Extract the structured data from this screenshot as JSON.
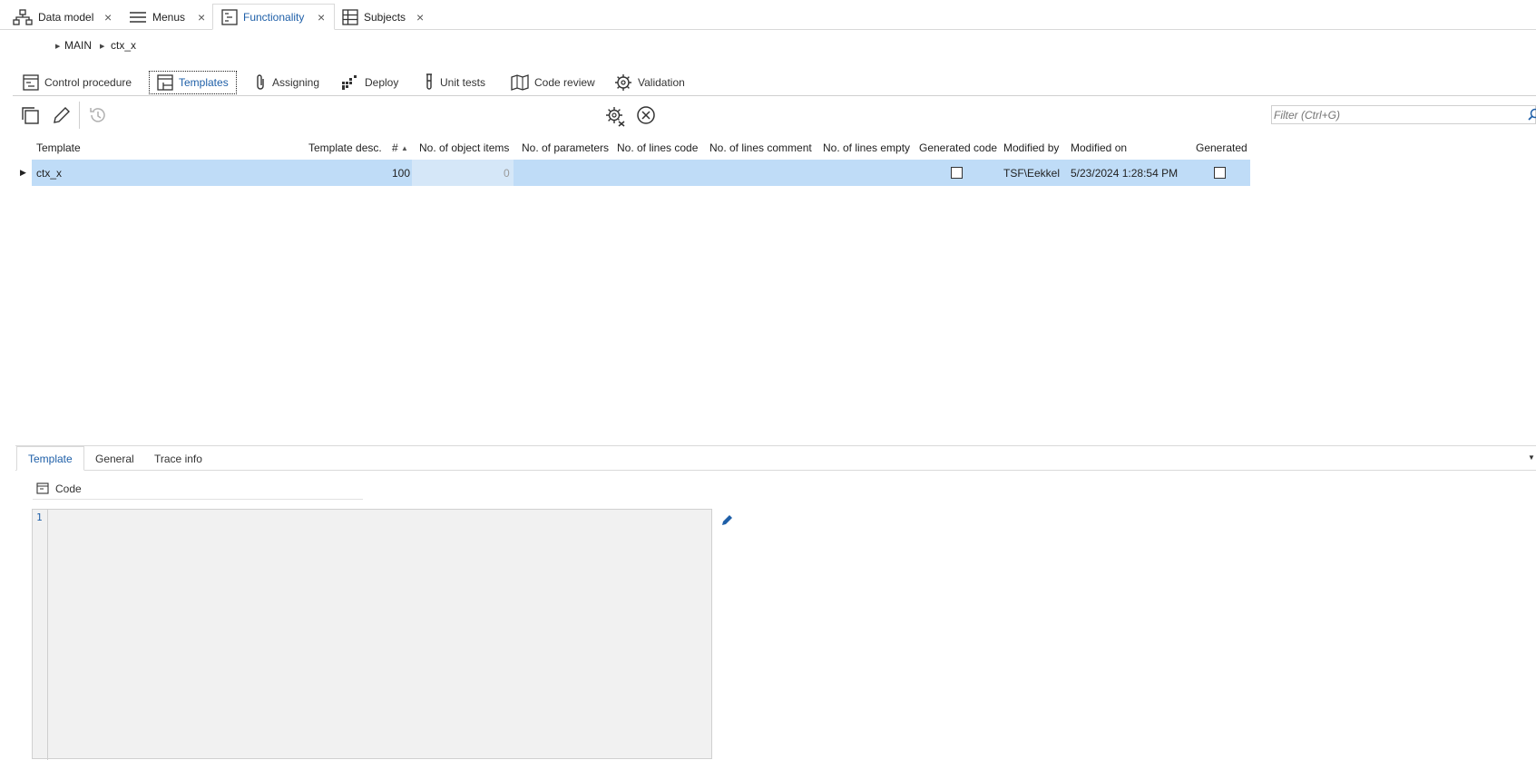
{
  "doc_tabs": [
    {
      "label": "Data model",
      "icon": "sitemap-icon",
      "close": "×"
    },
    {
      "label": "Menus",
      "icon": "menu-icon",
      "close": "×"
    },
    {
      "label": "Functionality",
      "icon": "functionality-icon",
      "close": "×"
    },
    {
      "label": "Subjects",
      "icon": "grid-icon",
      "close": "×"
    }
  ],
  "breadcrumb": {
    "root": "MAIN",
    "current": "ctx_x"
  },
  "function_tabs": [
    {
      "label": "Control procedure",
      "icon": "control-procedure-icon"
    },
    {
      "label": "Templates",
      "icon": "templates-icon"
    },
    {
      "label": "Assigning",
      "icon": "paperclip-icon"
    },
    {
      "label": "Deploy",
      "icon": "deploy-icon"
    },
    {
      "label": "Unit tests",
      "icon": "test-tube-icon"
    },
    {
      "label": "Code review",
      "icon": "code-review-icon"
    },
    {
      "label": "Validation",
      "icon": "validation-gear-icon"
    }
  ],
  "toolbar": {
    "filter_placeholder": "Filter (Ctrl+G)"
  },
  "table": {
    "columns": [
      "Template",
      "Template desc.",
      "#",
      "No. of object items",
      "No. of parameters",
      "No. of lines code",
      "No. of lines comment",
      "No. of lines empty",
      "Generated code",
      "Modified by",
      "Modified on",
      "Generated"
    ],
    "rows": [
      {
        "template": "ctx_x",
        "desc": "",
        "num": "100",
        "object_items": "0",
        "parameters": "",
        "lines_code": "",
        "lines_comment": "",
        "lines_empty": "",
        "generated_code": false,
        "modified_by": "TSF\\Eekkel",
        "modified_on": "5/23/2024 1:28:54 PM",
        "generated": false
      }
    ]
  },
  "detail_tabs": [
    "Template",
    "General",
    "Trace info"
  ],
  "code_section": {
    "label": "Code",
    "line_number": "1"
  },
  "colors": {
    "accent": "#1e5fa8",
    "selection": "#bfdcf7",
    "editor_bg": "#f1f1f1"
  }
}
